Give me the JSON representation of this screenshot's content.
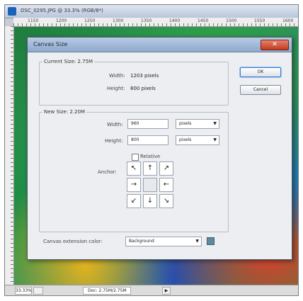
{
  "window": {
    "title": "DSC_0295.JPG @ 33.3% (RGB/8*)"
  },
  "ruler": {
    "ticks": [
      "1150",
      "1200",
      "1250",
      "1300",
      "1350",
      "1400",
      "1450",
      "1500",
      "1550",
      "1600"
    ]
  },
  "status_bar": {
    "zoom": "33.33%",
    "doc_info": "Doc: 2.75M/2.75M"
  },
  "dialog": {
    "title": "Canvas Size",
    "ok_label": "OK",
    "cancel_label": "Cancel",
    "current_size": {
      "legend": "Current Size: 2.75M",
      "width_label": "Width:",
      "width_value": "1203 pixels",
      "height_label": "Height:",
      "height_value": "800 pixels"
    },
    "new_size": {
      "legend": "New Size: 2.20M",
      "width_label": "Width:",
      "width_value": "960",
      "width_unit": "pixels",
      "height_label": "Height:",
      "height_value": "800",
      "height_unit": "pixels",
      "relative_label": "Relative",
      "relative_checked": false,
      "anchor_label": "Anchor:"
    },
    "extension_color": {
      "label": "Canvas extension color:",
      "value": "Background",
      "swatch_color": "#5e8aa0"
    }
  },
  "colors": {
    "dialog_title_bar": "#8ea9cc",
    "close_button": "#c23b22"
  }
}
